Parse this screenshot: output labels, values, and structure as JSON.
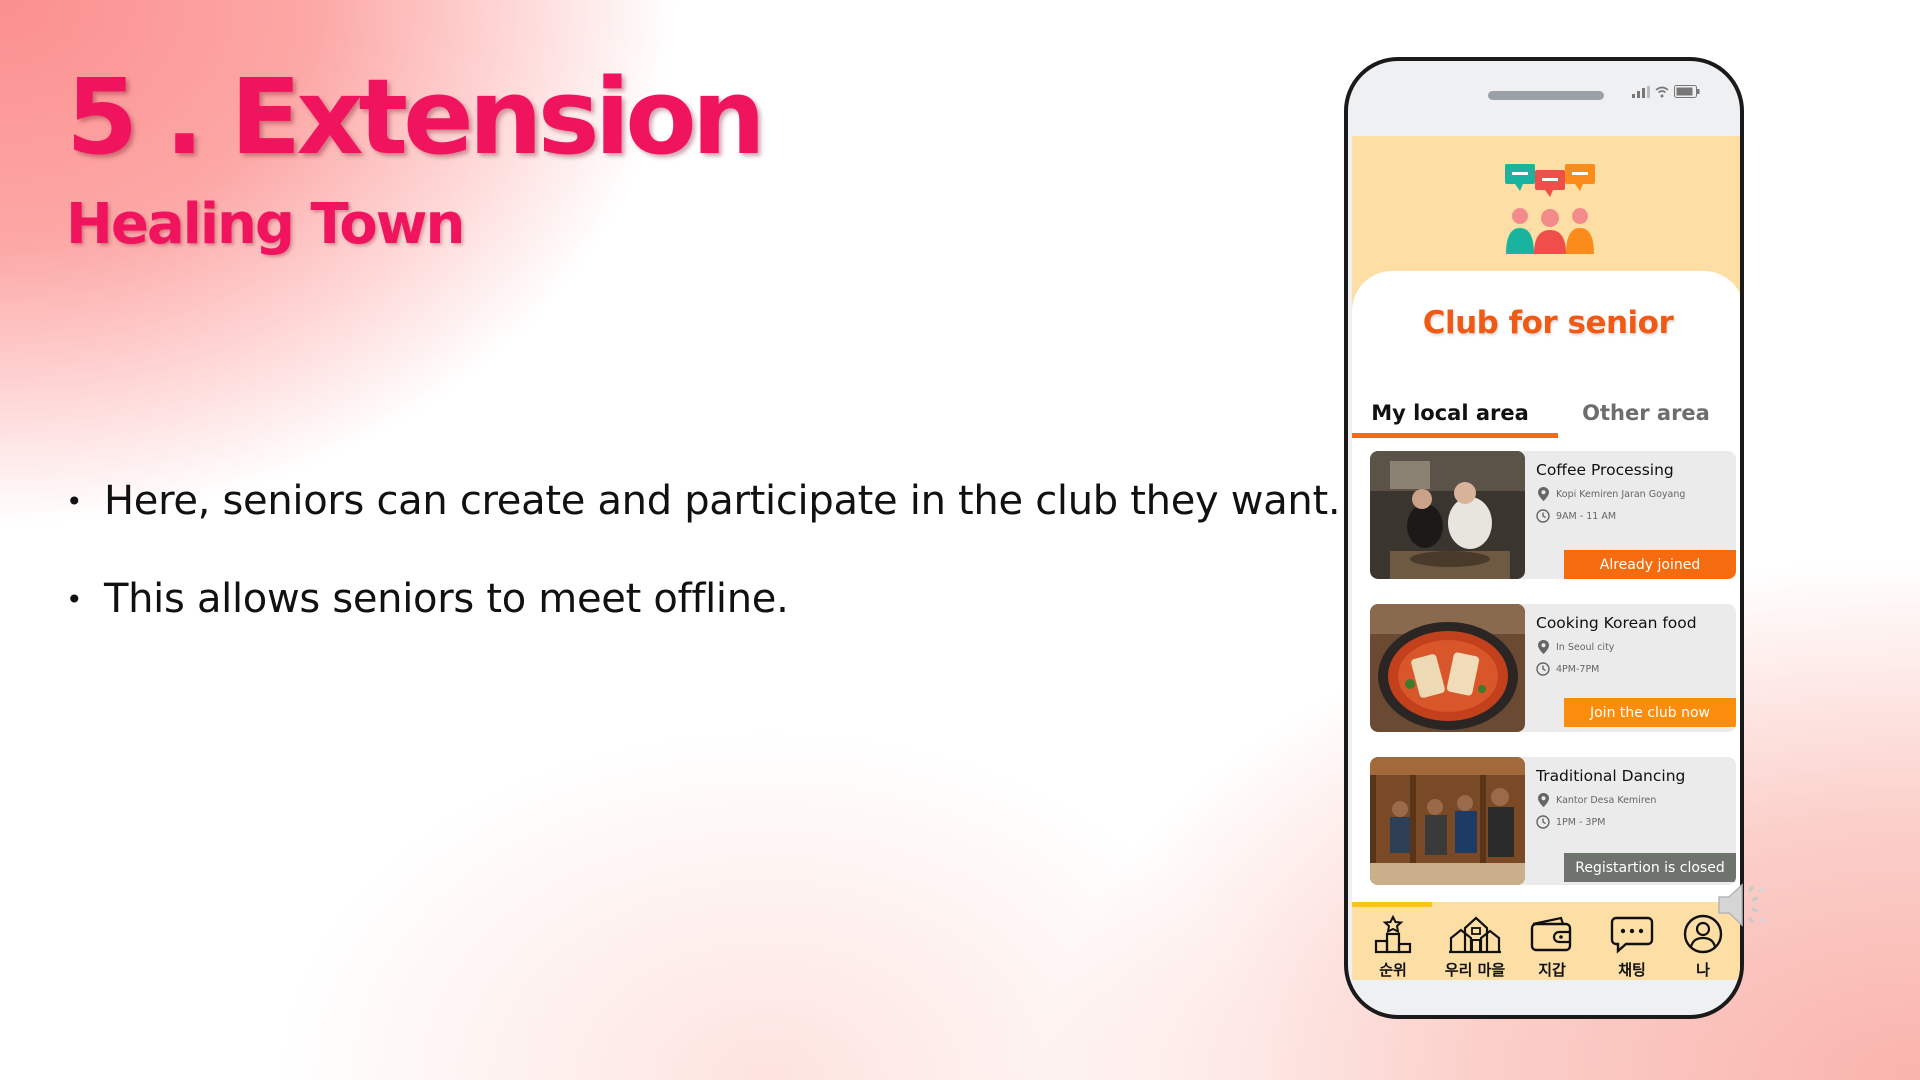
{
  "slide": {
    "title": "5 . Extension",
    "subtitle": "Healing Town",
    "bullets": [
      "Here, seniors can create and participate in the club they want.",
      "This allows seniors to meet offline."
    ]
  },
  "app": {
    "page_title": "Club for senior",
    "tabs": [
      {
        "label": "My local area",
        "active": true
      },
      {
        "label": "Other area",
        "active": false
      }
    ],
    "clubs": [
      {
        "title": "Coffee Processing",
        "location": "Kopi Kemiren Jaran Goyang",
        "time": "9AM - 11 AM",
        "button": "Already joined",
        "button_color": "#f56b0f"
      },
      {
        "title": "Cooking Korean food",
        "location": "In Seoul city",
        "time": "4PM-7PM",
        "button": "Join the club now",
        "button_color": "#fc8c0c"
      },
      {
        "title": "Traditional Dancing",
        "location": "Kantor Desa Kemiren",
        "time": "1PM - 3PM",
        "button": "Registartion is closed",
        "button_color": "#6f736e"
      }
    ],
    "nav": [
      {
        "label": "순위",
        "icon": "ranking-icon"
      },
      {
        "label": "우리 마을",
        "icon": "village-icon"
      },
      {
        "label": "지갑",
        "icon": "wallet-icon"
      },
      {
        "label": "채팅",
        "icon": "chat-icon"
      },
      {
        "label": "나",
        "icon": "profile-icon"
      }
    ]
  },
  "colors": {
    "title": "#f0145f",
    "accent_orange": "#f05a14",
    "header_bg": "#fddfa6"
  }
}
